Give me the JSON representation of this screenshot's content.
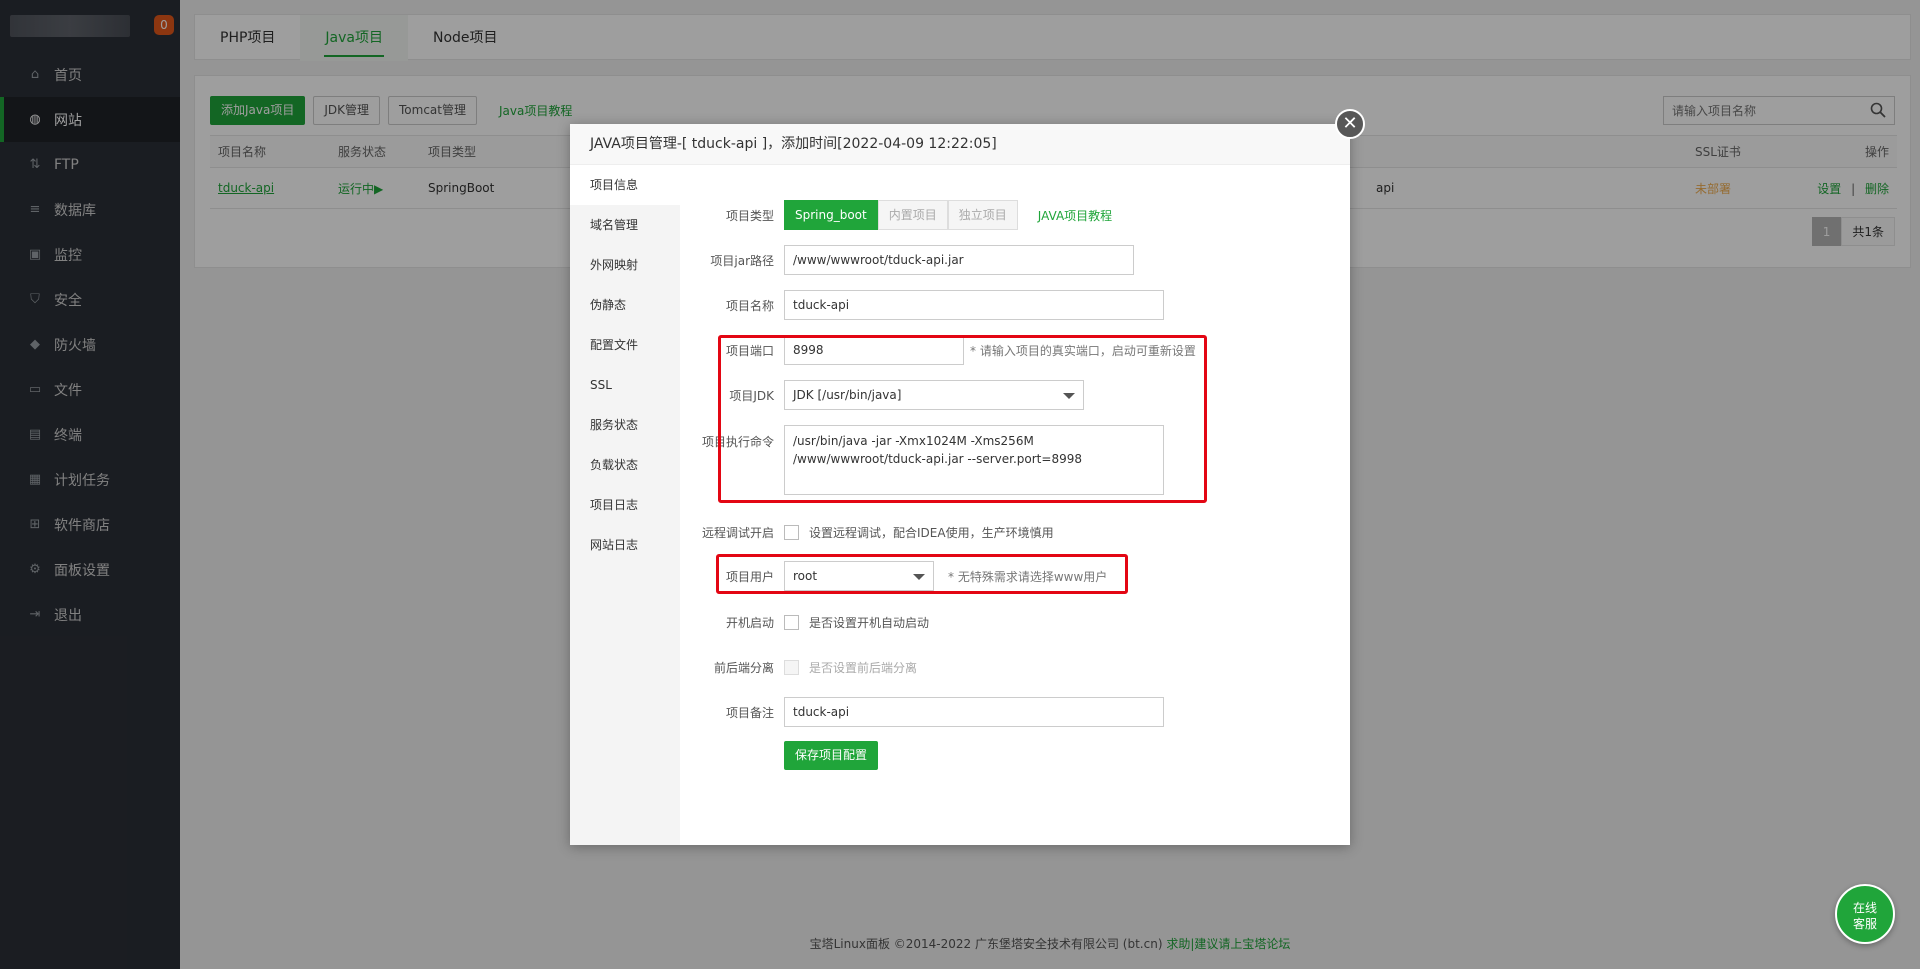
{
  "sidebar": {
    "badge": "0",
    "items": [
      {
        "label": "首页",
        "icon": "home-icon"
      },
      {
        "label": "网站",
        "icon": "globe-icon"
      },
      {
        "label": "FTP",
        "icon": "ftp-icon"
      },
      {
        "label": "数据库",
        "icon": "database-icon"
      },
      {
        "label": "监控",
        "icon": "monitor-icon"
      },
      {
        "label": "安全",
        "icon": "shield-icon"
      },
      {
        "label": "防火墙",
        "icon": "firewall-icon"
      },
      {
        "label": "文件",
        "icon": "folder-icon"
      },
      {
        "label": "终端",
        "icon": "terminal-icon"
      },
      {
        "label": "计划任务",
        "icon": "calendar-icon"
      },
      {
        "label": "软件商店",
        "icon": "apps-icon"
      },
      {
        "label": "面板设置",
        "icon": "gear-icon"
      },
      {
        "label": "退出",
        "icon": "logout-icon"
      }
    ]
  },
  "tabs": [
    "PHP项目",
    "Java项目",
    "Node项目"
  ],
  "toolbar": {
    "add_java": "添加Java项目",
    "jdk": "JDK管理",
    "tomcat": "Tomcat管理",
    "tutorial": "Java项目教程",
    "search_placeholder": "请输入项目名称"
  },
  "table": {
    "headers": {
      "name": "项目名称",
      "status": "服务状态",
      "type": "项目类型",
      "ssl": "SSL证书",
      "ops": "操作"
    },
    "row": {
      "name": "tduck-api",
      "status": "运行中▶",
      "type": "SpringBoot",
      "path": "api",
      "ssl": "未部署",
      "set": "设置",
      "sep": "|",
      "del": "删除"
    }
  },
  "pager": {
    "page": "1",
    "total": "共1条"
  },
  "footer": {
    "copyright": "宝塔Linux面板 ©2014-2022 广东堡塔安全技术有限公司 (bt.cn)",
    "help": "求助|建议请上宝塔论坛"
  },
  "modal": {
    "title": "JAVA项目管理-[ tduck-api ]，添加时间[2022-04-09 12:22:05]",
    "nav": [
      "项目信息",
      "域名管理",
      "外网映射",
      "伪静态",
      "配置文件",
      "SSL",
      "服务状态",
      "负载状态",
      "项目日志",
      "网站日志"
    ],
    "form": {
      "type_label": "项目类型",
      "type_options": [
        "Spring_boot",
        "内置项目",
        "独立项目"
      ],
      "type_tutorial": "JAVA项目教程",
      "jar_label": "项目jar路径",
      "jar_value": "/www/wwwroot/tduck-api.jar",
      "name_label": "项目名称",
      "name_value": "tduck-api",
      "port_label": "项目端口",
      "port_value": "8998",
      "port_hint": "* 请输入项目的真实端口，启动可重新设置",
      "jdk_label": "项目JDK",
      "jdk_value": "JDK [/usr/bin/java]",
      "cmd_label": "项目执行命令",
      "cmd_value": "/usr/bin/java -jar -Xmx1024M -Xms256M\n/www/wwwroot/tduck-api.jar --server.port=8998",
      "debug_label": "远程调试开启",
      "debug_hint": "设置远程调试，配合IDEA使用，生产环境慎用",
      "user_label": "项目用户",
      "user_value": "root",
      "user_hint": "* 无特殊需求请选择www用户",
      "boot_label": "开机启动",
      "boot_hint": "是否设置开机自动启动",
      "split_label": "前后端分离",
      "split_hint": "是否设置前后端分离",
      "remark_label": "项目备注",
      "remark_value": "tduck-api",
      "save": "保存项目配置"
    }
  },
  "chat": {
    "line1": "在线",
    "line2": "客服"
  },
  "colors": {
    "accent": "#20a53a",
    "highlight": "#e30613",
    "warning": "#f0ad4e"
  }
}
